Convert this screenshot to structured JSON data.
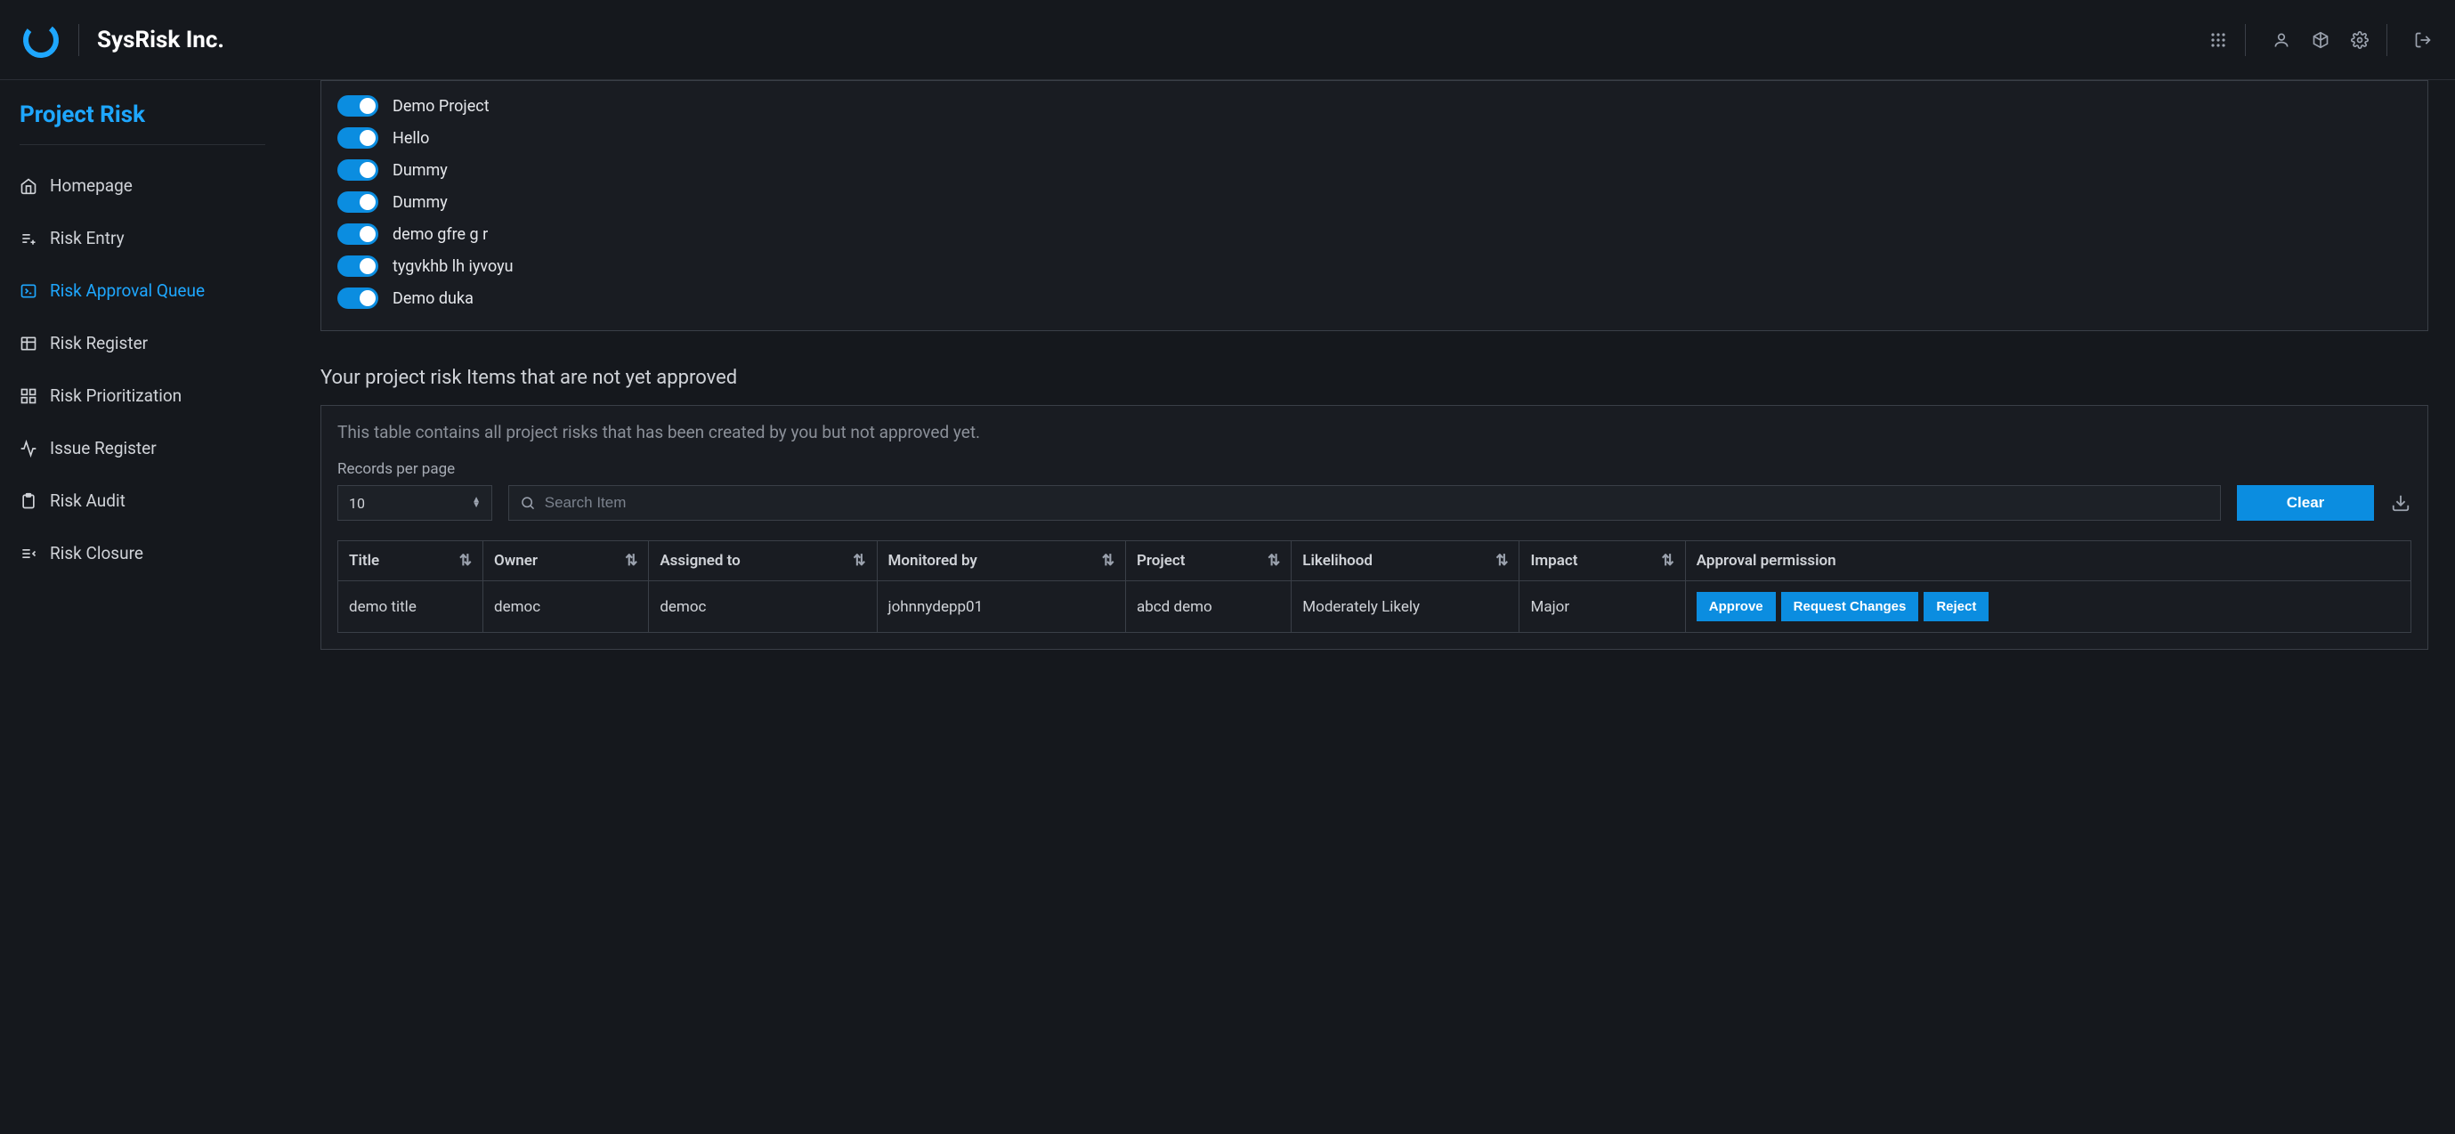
{
  "header": {
    "brand": "SysRisk Inc."
  },
  "sidebar": {
    "title": "Project Risk",
    "items": [
      {
        "label": "Homepage"
      },
      {
        "label": "Risk Entry"
      },
      {
        "label": "Risk Approval Queue"
      },
      {
        "label": "Risk Register"
      },
      {
        "label": "Risk Prioritization"
      },
      {
        "label": "Issue Register"
      },
      {
        "label": "Risk Audit"
      },
      {
        "label": "Risk Closure"
      }
    ]
  },
  "toggles": [
    {
      "label": "Demo Project"
    },
    {
      "label": "Hello"
    },
    {
      "label": "Dummy"
    },
    {
      "label": "Dummy"
    },
    {
      "label": "demo gfre g r"
    },
    {
      "label": "tygvkhb lh iyvoyu"
    },
    {
      "label": "Demo duka"
    }
  ],
  "section": {
    "heading": "Your project risk Items that are not yet approved",
    "desc": "This table contains all project risks that has been created by you but not approved yet.",
    "records_per_page_label": "Records per page",
    "records_per_page_value": "10",
    "search_placeholder": "Search Item",
    "clear_label": "Clear"
  },
  "table": {
    "columns": [
      "Title",
      "Owner",
      "Assigned to",
      "Monitored by",
      "Project",
      "Likelihood",
      "Impact",
      "Approval permission"
    ],
    "row": {
      "title": "demo title",
      "owner": "democ",
      "assigned_to": "democ",
      "monitored_by": "johnnydepp01",
      "project": "abcd demo",
      "likelihood": "Moderately Likely",
      "impact": "Major"
    },
    "actions": {
      "approve": "Approve",
      "request_changes": "Request Changes",
      "reject": "Reject"
    }
  }
}
